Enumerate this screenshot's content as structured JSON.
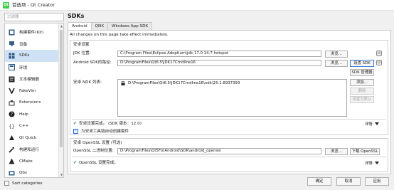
{
  "window": {
    "title": "首选项 - Qt Creator",
    "app_badge": "Qt"
  },
  "sidebar": {
    "search_placeholder": "过滤器",
    "items": [
      {
        "label": "构建套件(Kit)",
        "icon": "kit-icon"
      },
      {
        "label": "设备",
        "icon": "device-icon"
      },
      {
        "label": "SDKs",
        "icon": "sdk-icon",
        "active": true
      },
      {
        "label": "环境",
        "icon": "environment-icon"
      },
      {
        "label": "文本编辑器",
        "icon": "text-editor-icon"
      },
      {
        "label": "FakeVim",
        "icon": "fakevim-icon"
      },
      {
        "label": "Extensions",
        "icon": "extensions-icon"
      },
      {
        "label": "Help",
        "icon": "help-icon"
      },
      {
        "label": "C++",
        "icon": "cpp-icon"
      },
      {
        "label": "Qt Quick",
        "icon": "qt-quick-icon"
      },
      {
        "label": "构建和运行",
        "icon": "build-run-icon"
      },
      {
        "label": "CMake",
        "icon": "cmake-icon"
      },
      {
        "label": "Qbs",
        "icon": "qbs-icon"
      }
    ],
    "sort_label": "Sort categories"
  },
  "main": {
    "title": "SDKs",
    "tabs": [
      "Android",
      "QNX",
      "Windows App SDK"
    ],
    "active_tab": "Android",
    "info": "All changes on this page take effect immediately.",
    "android_settings": {
      "group_title": "安卓设置",
      "jdk_label": "JDK 位置:",
      "jdk_value": "C:\\Program Files\\Eclipse Adoptium\\jdk-17.0.14.7-hotspot",
      "browse_label": "浏览...",
      "sdk_label": "Android SDK的路径:",
      "sdk_value": "D:\\ProgramFiles\\Qt6.5\\JDK17Cmdline16",
      "setup_sdk_label": "设置 SDK",
      "sdk_manager_label": "SDK 管理器",
      "ndk_label": "安卓 NDK 列表:",
      "ndk_items": [
        "D:\\ProgramFiles\\Qt6.5\\JDK17Cmdline16\\ndk\\25.1.8937393"
      ],
      "add_label": "添加...",
      "remove_label": "删除",
      "set_default_label": "设置为默认",
      "status_text": "安卓设置完成。 (SDK 版本：12.0)",
      "details_label": "详情",
      "auto_download_label": "为安卓工具链自动创建套件",
      "auto_download_checked": true
    },
    "openssl": {
      "group_title": "安卓 OpenSSL 设置 (可选)",
      "path_label": "OpenSSL 二进制位置:",
      "path_value": "D:\\ProgramFiles\\Qt5ForAndroid\\SDK\\android_openssl",
      "browse_label": "浏览...",
      "download_label": "下载 OpenSSL",
      "status_text": "OpenSSL 设置完成。",
      "details_label": "详情"
    }
  },
  "footer": {
    "ok": "确定",
    "cancel": "取消",
    "apply": "应用"
  },
  "colors": {
    "selection": "#cfe1f5",
    "check": "#2b9b3a",
    "accent": "#41cd52"
  }
}
